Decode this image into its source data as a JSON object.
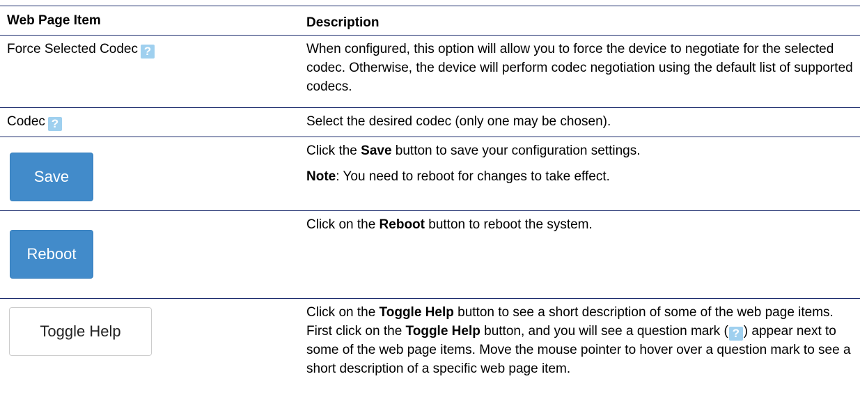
{
  "header": {
    "col1": "Web Page Item",
    "col2": "Description"
  },
  "rows": [
    {
      "item": "Force Selected Codec",
      "description": "When configured, this option will allow you to force the device to negotiate for the selected codec. Otherwise, the device will perform codec negotiation using the default list of supported codecs."
    },
    {
      "item": "Codec",
      "description": "Select the desired codec (only one may be chosen)."
    },
    {
      "button": "Save",
      "desc_pre": "Click the ",
      "desc_bold": "Save",
      "desc_post": " button to save your configuration settings.",
      "note_label": "Note",
      "note_text": ": You need to reboot for changes to take effect."
    },
    {
      "button": "Reboot",
      "desc_pre": "Click on the ",
      "desc_bold": "Reboot",
      "desc_post": " button to reboot the system."
    },
    {
      "button": "Toggle Help",
      "desc_1": "Click on the ",
      "desc_b1": "Toggle Help",
      "desc_2": " button to see a short description of some of the web page items. First click on the ",
      "desc_b2": "Toggle Help",
      "desc_3": " button, and you will see a question mark (",
      "desc_4": ") appear next to some of the web page items. Move the mouse pointer to hover over a question mark to see a short description of a specific web page item."
    }
  ],
  "help_icon": "question-mark-icon",
  "colors": {
    "rule": "#1a2a6c",
    "button_blue": "#428bca",
    "help_icon_bg": "#9fd0ef"
  }
}
